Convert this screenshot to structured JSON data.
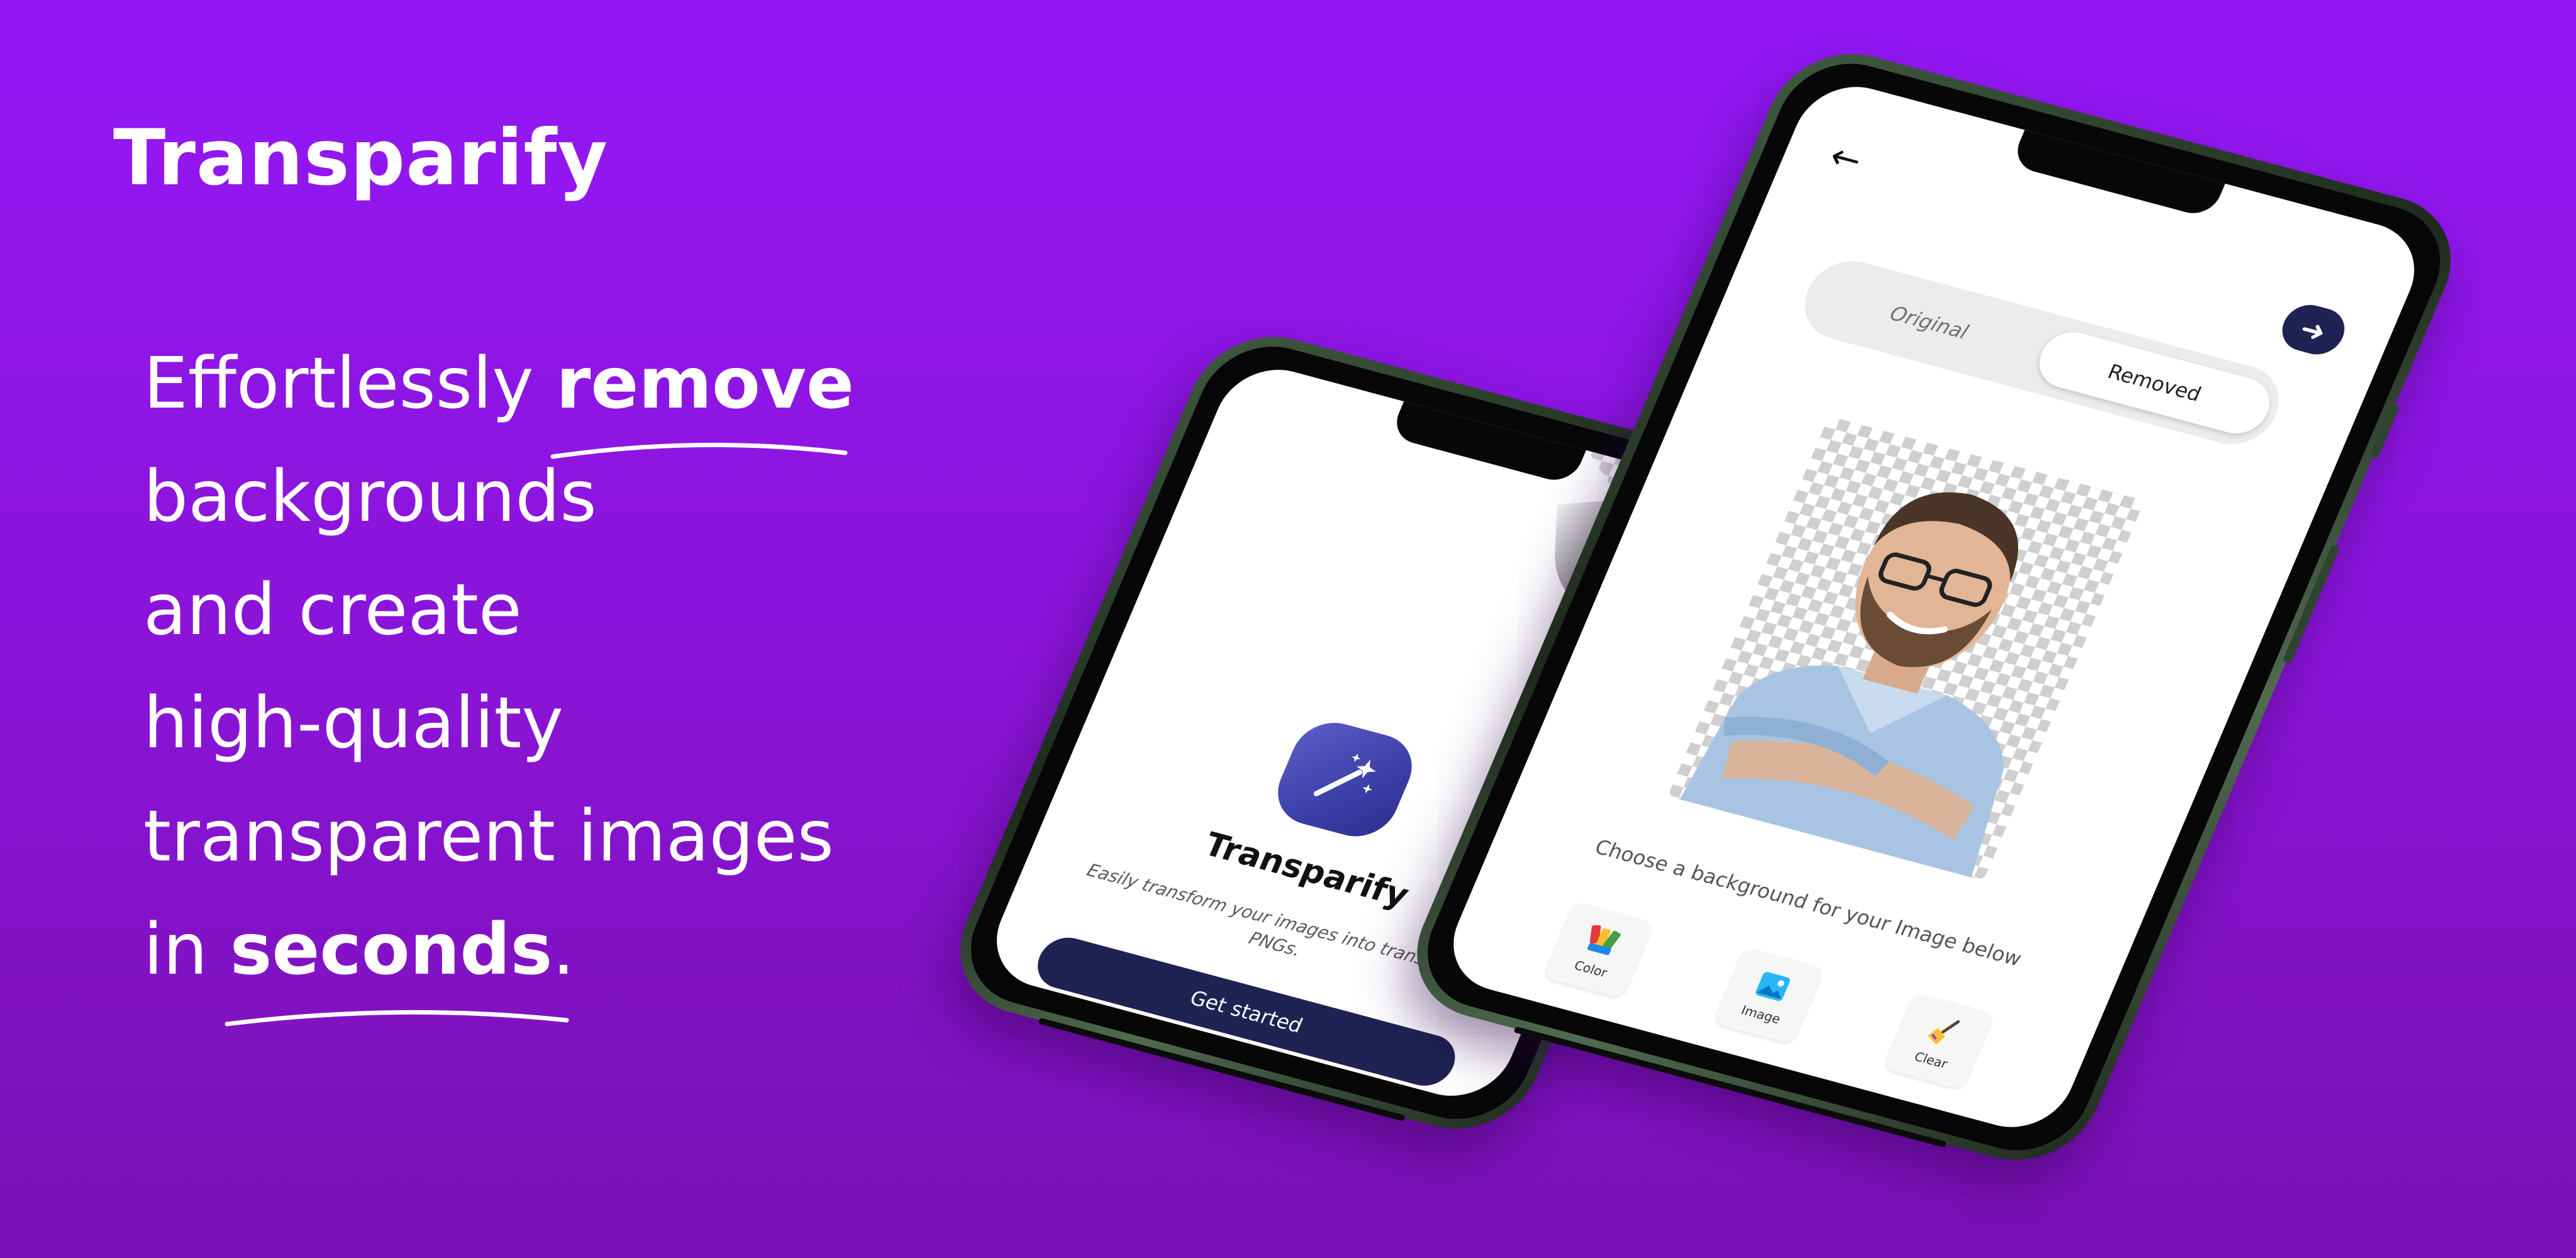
{
  "brand": {
    "title": "Transparify"
  },
  "headline": {
    "l1_a": "Effortlessly ",
    "l1_b": "remove",
    "l2": "backgrounds",
    "l3": "and create",
    "l4": "high-quality",
    "l5": "transparent images",
    "l6_a": "in ",
    "l6_b": "seconds",
    "l6_c": "."
  },
  "phone1": {
    "app_name": "Transparify",
    "tagline": "Easily transform your images into transparent PNGs.",
    "cta_label": "Get started",
    "icon": "magic-wand-icon"
  },
  "phone2": {
    "back_icon": "back-arrow-icon",
    "next_icon": "arrow-right-icon",
    "toggle": {
      "original": "Original",
      "removed": "Removed",
      "selected": "Removed"
    },
    "prompt": "Choose a background for your Image below",
    "options": [
      {
        "label": "Color",
        "icon": "color-palette-icon"
      },
      {
        "label": "Image",
        "icon": "image-icon"
      },
      {
        "label": "Clear",
        "icon": "broom-icon"
      }
    ]
  },
  "colors": {
    "background_top": "#9418f7",
    "background_bottom": "#7a10b3",
    "button": "#1f2253",
    "text_light": "#ffffff"
  }
}
